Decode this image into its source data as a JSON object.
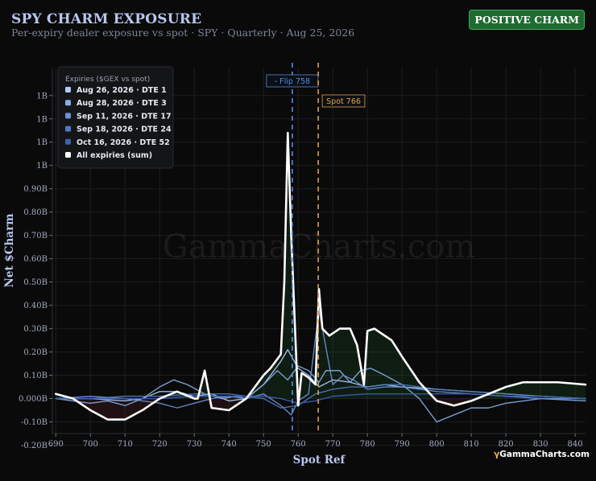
{
  "header": {
    "title": "SPY CHARM EXPOSURE",
    "subtitle": "Per-expiry dealer exposure vs spot · SPY · Quarterly · Aug 25, 2026",
    "badge": "POSITIVE CHARM",
    "watermark": "GammaCharts.com",
    "brand": "GammaCharts.com",
    "brand_glyph": "γ"
  },
  "chart_data": {
    "type": "line",
    "xlabel": "Spot Ref",
    "ylabel": "Net $Charm",
    "xlim": [
      689,
      843
    ],
    "ylim": [
      -0.25,
      1.32
    ],
    "x_ticks": [
      690,
      700,
      710,
      720,
      730,
      740,
      750,
      760,
      770,
      780,
      790,
      800,
      810,
      820,
      830,
      840
    ],
    "y_ticks": [
      {
        "v": 1.2,
        "label": "1B"
      },
      {
        "v": 1.1,
        "label": "1B"
      },
      {
        "v": 1.0,
        "label": "1B"
      },
      {
        "v": 0.9,
        "label": "1B"
      },
      {
        "v": 0.8,
        "label": "0.90B"
      },
      {
        "v": 0.7,
        "label": "0.80B"
      },
      {
        "v": 0.6,
        "label": "0.70B"
      },
      {
        "v": 0.5,
        "label": "0.60B"
      },
      {
        "v": 0.4,
        "label": "0.50B"
      },
      {
        "v": 0.3,
        "label": "0.40B"
      },
      {
        "v": 0.2,
        "label": "0.30B"
      },
      {
        "v": 0.1,
        "label": "0.20B"
      },
      {
        "v": 0.0,
        "label": "0.10B"
      },
      {
        "v": -0.1,
        "label": "0.000B"
      },
      {
        "v": -0.2,
        "label": "-0.10B"
      },
      {
        "v": -0.3,
        "label": "-0.20B"
      }
    ],
    "grid": true,
    "legend_placement": "top-left",
    "legend_title": "Expiries ($GEX vs spot)",
    "annotations": [
      {
        "label": "- Flip 758",
        "x": 758.3,
        "color": "#4f8ee6"
      },
      {
        "label": "Spot 766",
        "x": 765.8,
        "color": "#e0a040"
      }
    ],
    "series": [
      {
        "name": "Aug 26, 2026 · DTE 1",
        "color": "#aecdf6",
        "x": [
          690,
          700,
          710,
          715,
          720,
          725,
          730,
          735,
          740,
          745,
          750,
          755,
          757,
          760,
          763,
          766,
          770,
          775,
          780,
          785,
          790,
          800,
          810,
          820,
          830,
          843
        ],
        "y": [
          0.0,
          0.0,
          -0.01,
          0.0,
          0.03,
          0.03,
          0.01,
          0.02,
          -0.01,
          0.0,
          0.06,
          0.16,
          0.21,
          0.13,
          0.1,
          0.05,
          0.08,
          0.07,
          0.05,
          0.06,
          0.05,
          0.04,
          0.03,
          0.02,
          0.01,
          0.0
        ]
      },
      {
        "name": "Aug 28, 2026 · DTE 3",
        "color": "#85aee8",
        "x": [
          690,
          700,
          705,
          710,
          715,
          720,
          724,
          728,
          733,
          738,
          742,
          745,
          750,
          754,
          757,
          760,
          763,
          766,
          768,
          772,
          775,
          778,
          781,
          785,
          790,
          795,
          800,
          805,
          810,
          815,
          820,
          830,
          843
        ],
        "y": [
          0.0,
          -0.02,
          -0.01,
          -0.03,
          0.0,
          0.05,
          0.08,
          0.06,
          0.02,
          0.0,
          0.01,
          0.0,
          0.06,
          0.12,
          0.08,
          0.14,
          0.12,
          0.07,
          0.12,
          0.12,
          0.07,
          0.12,
          0.13,
          0.1,
          0.06,
          0.0,
          -0.1,
          -0.07,
          -0.04,
          -0.04,
          -0.02,
          0.0,
          -0.01
        ]
      },
      {
        "name": "Sep 11, 2026 · DTE 17",
        "color": "#6d93d6",
        "x": [
          690,
          700,
          710,
          720,
          725,
          730,
          735,
          740,
          745,
          750,
          755,
          758,
          760,
          763,
          766,
          770,
          773,
          776,
          780,
          785,
          790,
          800,
          810,
          820,
          830,
          843
        ],
        "y": [
          0.0,
          0.01,
          0.0,
          -0.02,
          -0.04,
          -0.02,
          0.0,
          0.01,
          0.0,
          0.02,
          -0.03,
          -0.07,
          -0.01,
          0.02,
          0.38,
          0.06,
          0.1,
          0.08,
          0.04,
          0.05,
          0.05,
          0.03,
          0.02,
          0.01,
          0.0,
          0.0
        ]
      },
      {
        "name": "Sep 18, 2026 · DTE 24",
        "color": "#4f79c2",
        "x": [
          690,
          700,
          710,
          720,
          730,
          740,
          750,
          755,
          760,
          765,
          770,
          775,
          780,
          785,
          790,
          800,
          810,
          820,
          830,
          843
        ],
        "y": [
          0.0,
          0.0,
          0.01,
          0.01,
          0.02,
          0.02,
          0.0,
          -0.04,
          -0.03,
          0.02,
          0.04,
          0.05,
          0.05,
          0.06,
          0.06,
          0.04,
          0.03,
          0.02,
          0.01,
          0.0
        ]
      },
      {
        "name": "Oct 16, 2026 · DTE 52",
        "color": "#3b63b0",
        "x": [
          690,
          700,
          710,
          720,
          730,
          740,
          750,
          755,
          760,
          765,
          770,
          780,
          790,
          800,
          810,
          820,
          830,
          843
        ],
        "y": [
          0.0,
          0.0,
          0.0,
          0.0,
          0.01,
          0.01,
          0.01,
          0.0,
          -0.02,
          -0.01,
          0.01,
          0.02,
          0.02,
          0.02,
          0.02,
          0.01,
          0.01,
          0.0
        ]
      },
      {
        "name": "All expiries (sum)",
        "color": "#ffffff",
        "x": [
          690,
          695,
          700,
          705,
          710,
          715,
          720,
          725,
          730,
          731,
          733,
          735,
          740,
          745,
          750,
          752,
          755,
          756,
          757,
          758,
          760,
          761,
          763,
          765,
          766,
          767,
          769,
          772,
          775,
          777,
          779,
          780,
          782,
          784,
          787,
          790,
          795,
          800,
          805,
          810,
          815,
          820,
          825,
          830,
          835,
          843
        ],
        "y": [
          0.02,
          0.0,
          -0.05,
          -0.09,
          -0.09,
          -0.05,
          0.0,
          0.03,
          0.0,
          0.0,
          0.12,
          -0.04,
          -0.05,
          0.0,
          0.1,
          0.13,
          0.19,
          0.5,
          1.14,
          0.7,
          -0.03,
          0.11,
          0.09,
          0.06,
          0.47,
          0.3,
          0.27,
          0.3,
          0.3,
          0.23,
          0.06,
          0.29,
          0.3,
          0.28,
          0.25,
          0.18,
          0.07,
          -0.01,
          -0.03,
          -0.01,
          0.02,
          0.05,
          0.07,
          0.07,
          0.07,
          0.06
        ]
      }
    ]
  }
}
